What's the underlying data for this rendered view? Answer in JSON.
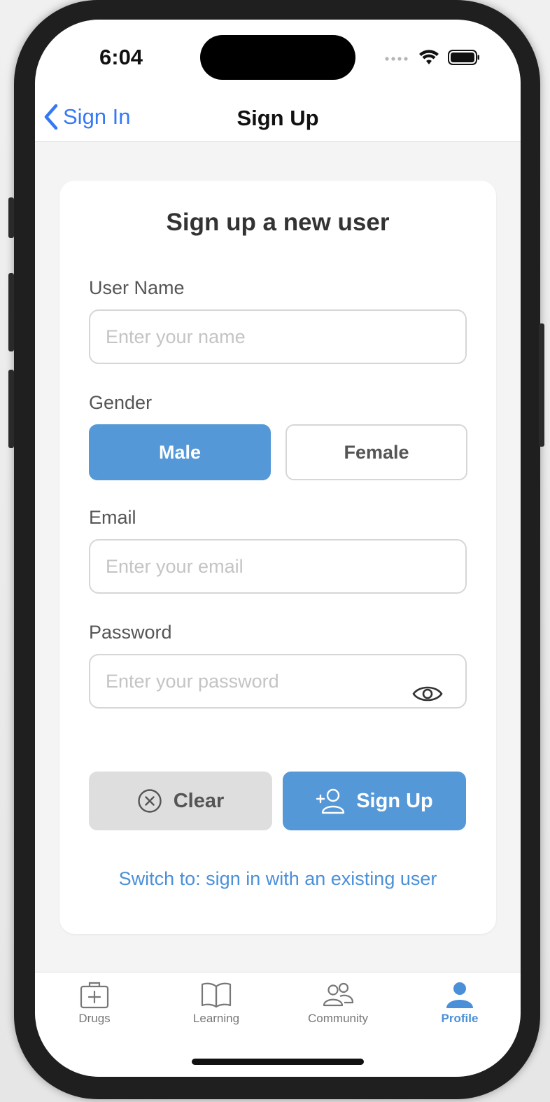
{
  "status_bar": {
    "time": "6:04"
  },
  "nav": {
    "back_label": "Sign In",
    "title": "Sign Up"
  },
  "form": {
    "title": "Sign up a new user",
    "username_label": "User Name",
    "username_placeholder": "Enter your name",
    "username_value": "",
    "gender_label": "Gender",
    "gender_options": [
      "Male",
      "Female"
    ],
    "gender_selected": "Male",
    "email_label": "Email",
    "email_placeholder": "Enter your email",
    "email_value": "",
    "password_label": "Password",
    "password_placeholder": "Enter your password",
    "password_value": "",
    "clear_label": "Clear",
    "signup_label": "Sign Up",
    "switch_label": "Switch to: sign in with an existing user"
  },
  "tabs": [
    {
      "label": "Drugs",
      "icon": "medical-kit-icon",
      "active": false
    },
    {
      "label": "Learning",
      "icon": "book-icon",
      "active": false
    },
    {
      "label": "Community",
      "icon": "people-icon",
      "active": false
    },
    {
      "label": "Profile",
      "icon": "person-icon",
      "active": true
    }
  ],
  "colors": {
    "accent": "#5598d8",
    "link": "#4a90d9",
    "ios_blue": "#3478f6",
    "clear_bg": "#dedede"
  }
}
